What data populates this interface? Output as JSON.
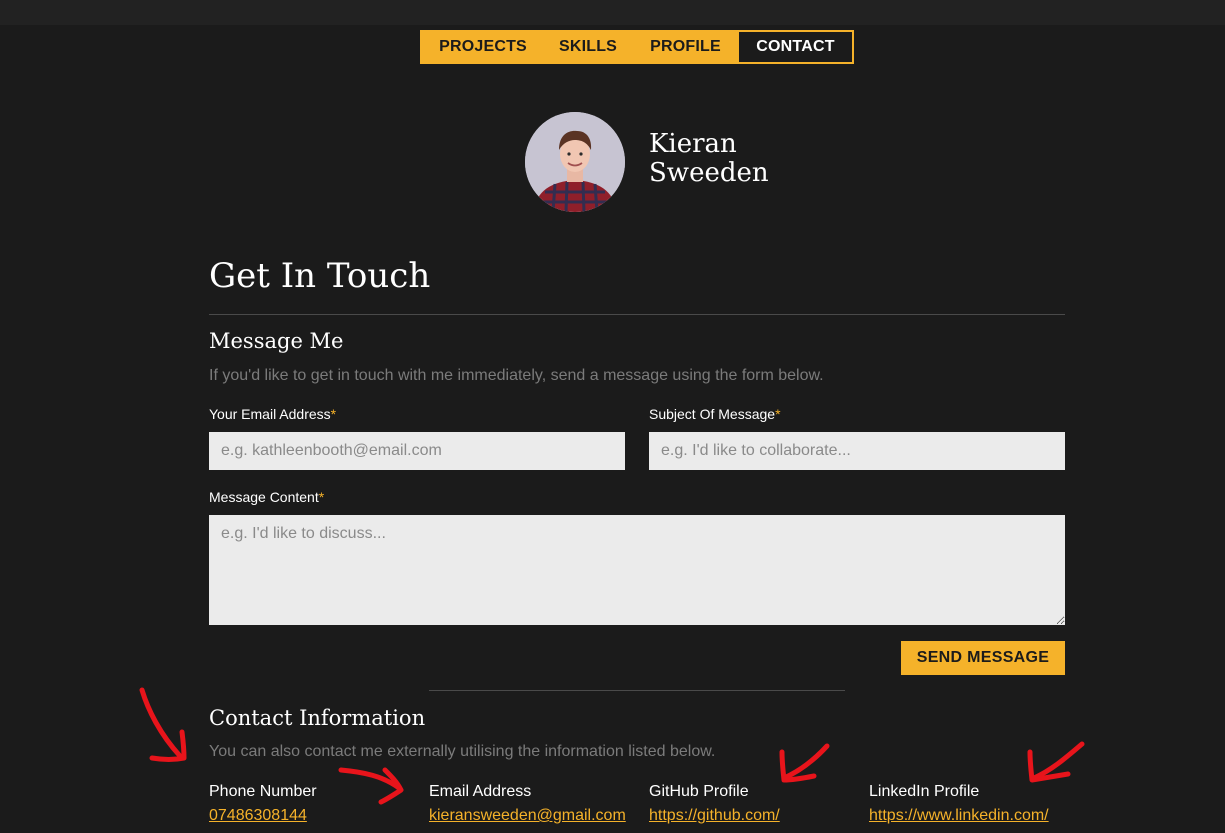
{
  "nav": {
    "items": [
      {
        "label": "PROJECTS"
      },
      {
        "label": "SKILLS"
      },
      {
        "label": "PROFILE"
      },
      {
        "label": "CONTACT"
      }
    ],
    "active": "CONTACT"
  },
  "profile": {
    "first_name": "Kieran",
    "last_name": "Sweeden"
  },
  "page_title": "Get In Touch",
  "message_section": {
    "title": "Message Me",
    "intro": "If you'd like to get in touch with me immediately, send a message using the form below.",
    "email_label": "Your Email Address",
    "email_placeholder": "e.g. kathleenbooth@email.com",
    "email_value": "",
    "subject_label": "Subject Of Message",
    "subject_placeholder": "e.g. I'd like to collaborate...",
    "subject_value": "",
    "content_label": "Message Content",
    "content_placeholder": "e.g. I'd like to discuss...",
    "content_value": "",
    "required_marker": "*",
    "send_label": "SEND MESSAGE"
  },
  "contact_info": {
    "title": "Contact Information",
    "intro": "You can also contact me externally utilising the information listed below.",
    "items": [
      {
        "label": "Phone Number",
        "value": "07486308144"
      },
      {
        "label": "Email Address",
        "value": "kieransweeden@gmail.com"
      },
      {
        "label": "GitHub Profile",
        "value": "https://github.com/"
      },
      {
        "label": "LinkedIn Profile",
        "value": "https://www.linkedin.com/"
      }
    ]
  },
  "colors": {
    "background": "#1b1b1b",
    "accent": "#f5b22a",
    "annotation_arrows": "#e8141b",
    "input_bg": "#ebebeb"
  }
}
